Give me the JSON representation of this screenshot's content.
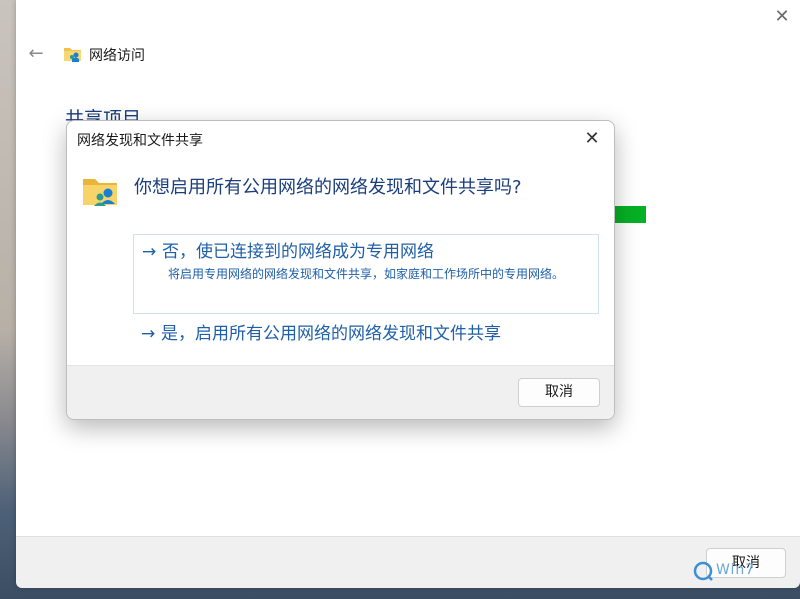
{
  "main_window": {
    "title": "网络访问",
    "section_heading": "共享项目",
    "cancel_label": "取消",
    "close_symbol": "✕",
    "back_symbol": "←",
    "progress_color": "#06b025"
  },
  "dialog": {
    "title": "网络发现和文件共享",
    "question": "你想启用所有公用网络的网络发现和文件共享吗?",
    "close_symbol": "✕",
    "options": [
      {
        "arrow": "→",
        "label": "否，使已连接到的网络成为专用网络",
        "description": "将启用专用网络的网络发现和文件共享，如家庭和工作场所中的专用网络。"
      },
      {
        "arrow": "→",
        "label": "是，启用所有公用网络的网络发现和文件共享"
      }
    ],
    "cancel_label": "取消"
  },
  "watermark": {
    "text": "Win7"
  },
  "colors": {
    "link": "#1f5fa8",
    "heading": "#1a3d7c"
  }
}
